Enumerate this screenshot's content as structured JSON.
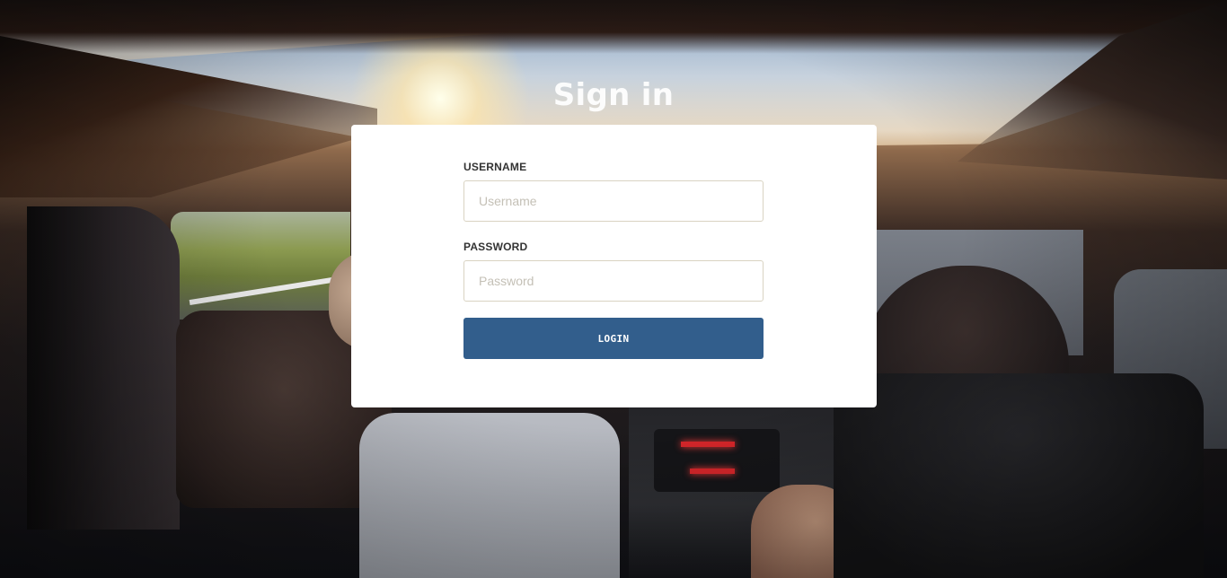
{
  "page": {
    "title": "Sign in"
  },
  "form": {
    "username": {
      "label": "USERNAME",
      "placeholder": "Username",
      "value": ""
    },
    "password": {
      "label": "PASSWORD",
      "placeholder": "Password",
      "value": ""
    },
    "submit_label": "LOGIN"
  },
  "colors": {
    "button": "#325e8c",
    "card": "#ffffff",
    "title": "#ffffff"
  },
  "background": {
    "description_icon": "car-interior-photo"
  }
}
